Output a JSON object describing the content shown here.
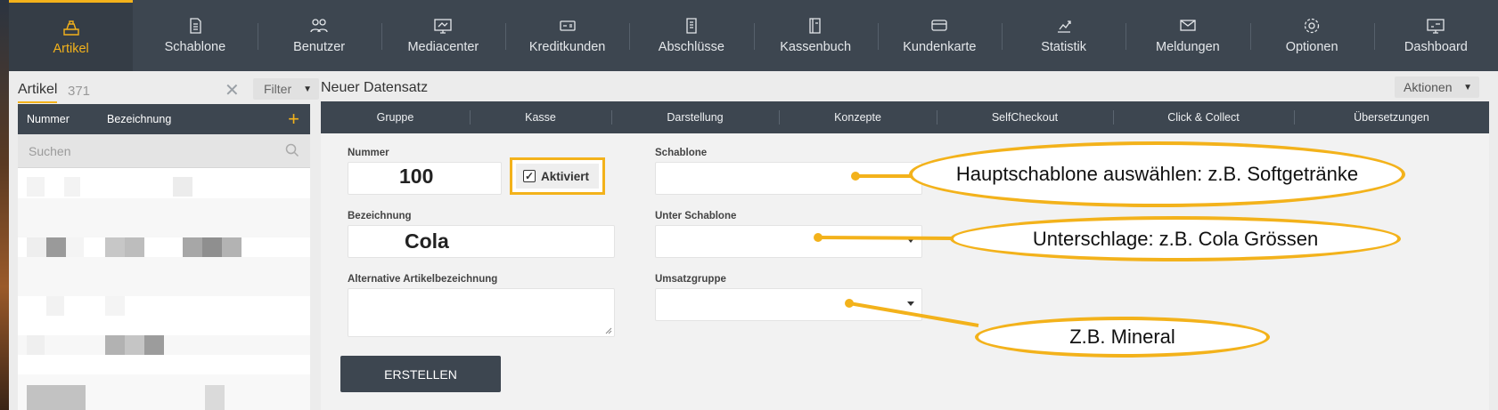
{
  "nav": {
    "items": [
      {
        "label": "Artikel",
        "icon": "cash-register-icon",
        "active": true
      },
      {
        "label": "Schablone",
        "icon": "document-icon"
      },
      {
        "label": "Benutzer",
        "icon": "users-icon"
      },
      {
        "label": "Mediacenter",
        "icon": "monitor-icon"
      },
      {
        "label": "Kreditkunden",
        "icon": "card-icon"
      },
      {
        "label": "Abschlüsse",
        "icon": "receipt-icon"
      },
      {
        "label": "Kassenbuch",
        "icon": "book-icon"
      },
      {
        "label": "Kundenkarte",
        "icon": "customer-card-icon"
      },
      {
        "label": "Statistik",
        "icon": "chart-hand-icon"
      },
      {
        "label": "Meldungen",
        "icon": "envelope-icon"
      },
      {
        "label": "Optionen",
        "icon": "gear-icon"
      },
      {
        "label": "Dashboard",
        "icon": "dashboard-icon"
      }
    ]
  },
  "sidebar": {
    "title": "Artikel",
    "count": "371",
    "filter_label": "Filter",
    "columns": [
      "Nummer",
      "Bezeichnung"
    ],
    "add_symbol": "+",
    "search_placeholder": "Suchen"
  },
  "form": {
    "title": "Neuer Datensatz",
    "actions_label": "Aktionen",
    "tabs": [
      "Gruppe",
      "Kasse",
      "Darstellung",
      "Konzepte",
      "SelfCheckout",
      "Click & Collect",
      "Übersetzungen"
    ],
    "nummer_label": "Nummer",
    "nummer_value": "100",
    "aktiviert_label": "Aktiviert",
    "bezeichnung_label": "Bezeichnung",
    "bezeichnung_value": "Cola",
    "alt_label": "Alternative Artikelbezeichnung",
    "schablone_label": "Schablone",
    "unter_label": "Unter Schablone",
    "umsatz_label": "Umsatzgruppe",
    "create_label": "ERSTELLEN"
  },
  "annotations": {
    "a1": "Hauptschablone auswählen: z.B. Softgetränke",
    "a2": "Unterschlage: z.B. Cola Grössen",
    "a3": "Z.B. Mineral"
  },
  "colors": {
    "accent": "#f3b21b",
    "nav_bg": "#3d4650"
  }
}
